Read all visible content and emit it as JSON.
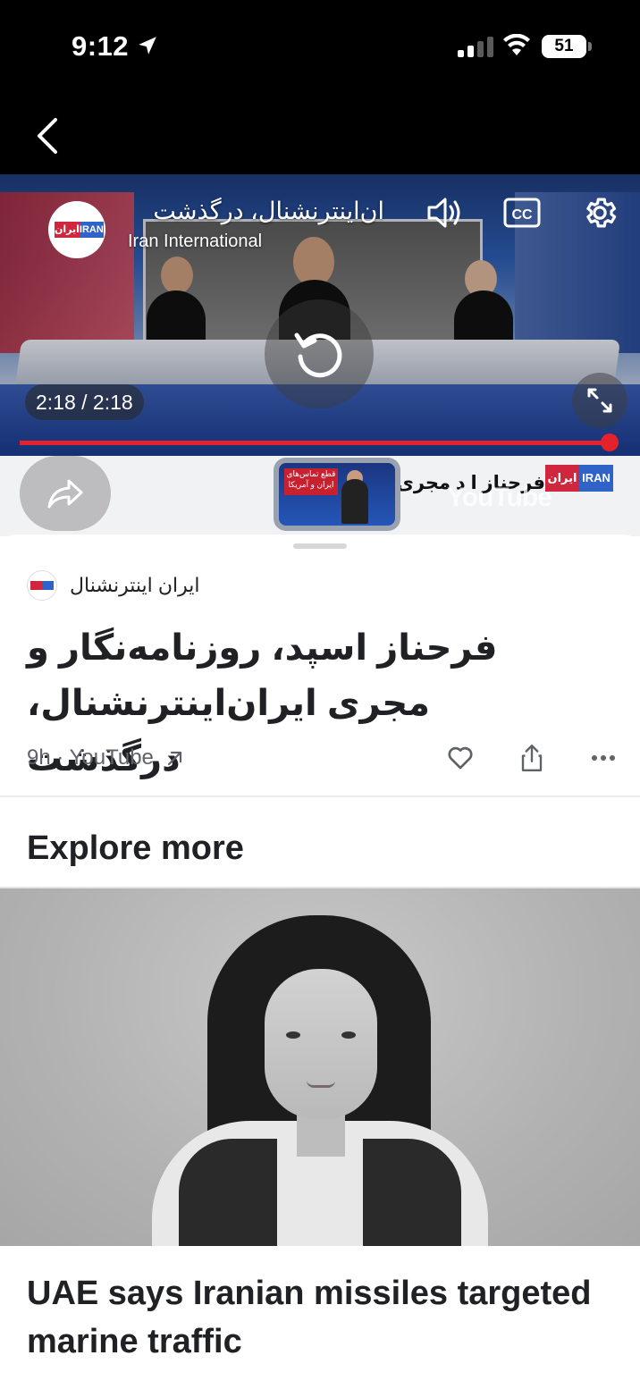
{
  "status": {
    "time": "9:12",
    "battery": "51"
  },
  "video": {
    "title": "ان‌اینترنشنال، درگذشت",
    "channel": "Iran International",
    "time_display": "2:18 / 2:18",
    "progress": 1.0,
    "logo_left": "ایران",
    "logo_right": "IRAN"
  },
  "ticker": {
    "text": "فرحناز ا  د مجری          نال بود",
    "logo_left": "ایران",
    "logo_right": "IRAN",
    "watermark": "YouTube",
    "thumb_caption": "قطع تماس‌های ایران و آمریکا"
  },
  "article": {
    "source_name": "ایران اینترنشنال",
    "headline": "فرحناز اسپد، روزنامه‌نگار و مجری ایران‌اینترنشنال، درگذشت",
    "meta": "9h · YouTube"
  },
  "explore": {
    "heading": "Explore more",
    "story_title": "UAE says Iranian missiles targeted marine traffic"
  }
}
